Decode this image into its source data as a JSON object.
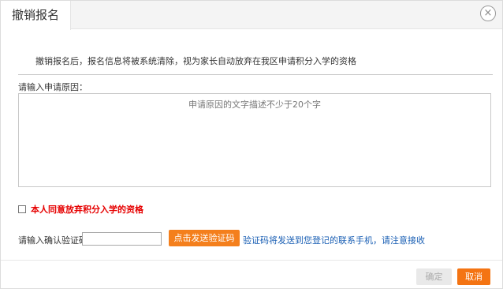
{
  "dialog": {
    "title": "撤销报名",
    "close_symbol": "×"
  },
  "notice": {
    "text": "撤销报名后，报名信息将被系统清除，视为家长自动放弃在我区申请积分入学的资格"
  },
  "reason": {
    "label": "请输入申请原因：",
    "placeholder": "申请原因的文字描述不少于20个字",
    "value": ""
  },
  "agreement": {
    "checked": false,
    "text": "本人同意放弃积分入学的资格"
  },
  "verification": {
    "label": "请输入确认验证码：",
    "value": "",
    "send_button": "点击发送验证码",
    "hint": "验证码将发送到您登记的联系手机，请注意接收"
  },
  "footer": {
    "ok_label": "确定",
    "cancel_label": "取消"
  },
  "colors": {
    "accent_orange": "#f47f1c",
    "warning_red": "#e60000",
    "link_blue": "#1a5fb4"
  }
}
